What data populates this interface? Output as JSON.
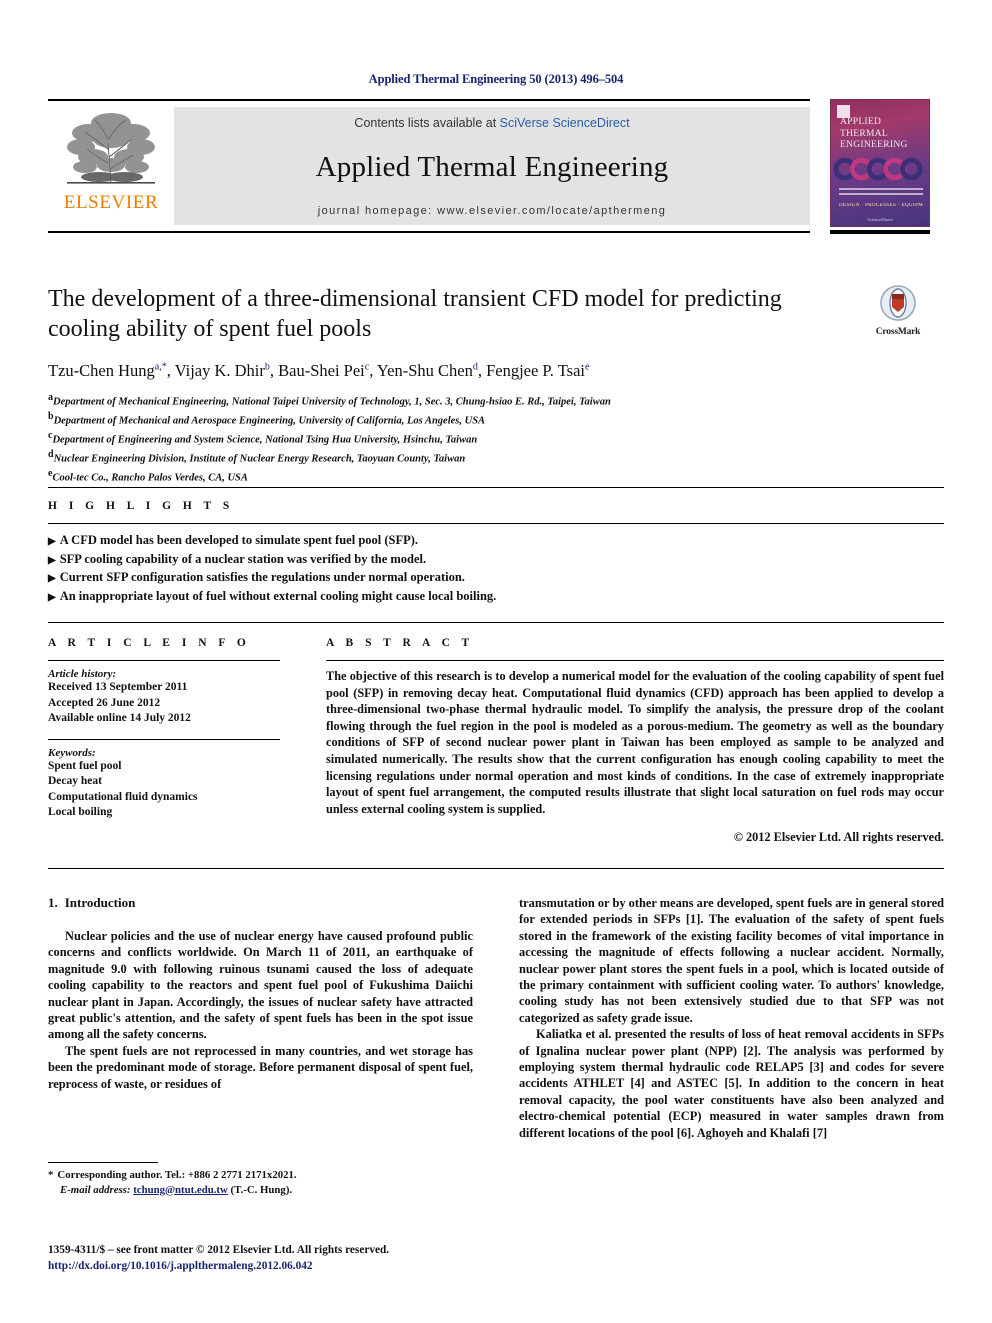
{
  "running_head": "Applied Thermal Engineering 50 (2013) 496–504",
  "masthead": {
    "contents_prefix": "Contents lists available at ",
    "contents_link": "SciVerse ScienceDirect",
    "journal_name": "Applied Thermal Engineering",
    "homepage": "journal homepage: www.elsevier.com/locate/apthermeng",
    "publisher_wordmark": "ELSEVIER",
    "publisher_logo_icon": "elsevier-tree-icon"
  },
  "cover": {
    "title_line1": "APPLIED",
    "title_line2": "THERMAL",
    "title_line3": "ENGINEERING",
    "keywords_strip": "DESIGN · PROCESSES · EQUIPMENT · ECONOMICS",
    "footer": "ScienceDirect"
  },
  "article": {
    "title": "The development of a three-dimensional transient CFD model for predicting cooling ability of spent fuel pools",
    "authors": [
      {
        "name": "Tzu-Chen Hung",
        "marks": "a,*"
      },
      {
        "name": "Vijay K. Dhir",
        "marks": "b"
      },
      {
        "name": "Bau-Shei Pei",
        "marks": "c"
      },
      {
        "name": "Yen-Shu Chen",
        "marks": "d"
      },
      {
        "name": "Fengjee P. Tsai",
        "marks": "e"
      }
    ],
    "affiliations": [
      {
        "mark": "a",
        "text": "Department of Mechanical Engineering, National Taipei University of Technology, 1, Sec. 3, Chung-hsiao E. Rd., Taipei, Taiwan"
      },
      {
        "mark": "b",
        "text": "Department of Mechanical and Aerospace Engineering, University of California, Los Angeles, USA"
      },
      {
        "mark": "c",
        "text": "Department of Engineering and System Science, National Tsing Hua University, Hsinchu, Taiwan"
      },
      {
        "mark": "d",
        "text": "Nuclear Engineering Division, Institute of Nuclear Energy Research, Taoyuan County, Taiwan"
      },
      {
        "mark": "e",
        "text": "Cool-tec Co., Rancho Palos Verdes, CA, USA"
      }
    ]
  },
  "crossmark": {
    "label": "CrossMark",
    "icon": "crossmark-icon"
  },
  "highlights": {
    "heading": "H I G H L I G H T S",
    "bullet_glyph": "▶",
    "items": [
      "A CFD model has been developed to simulate spent fuel pool (SFP).",
      "SFP cooling capability of a nuclear station was verified by the model.",
      "Current SFP configuration satisfies the regulations under normal operation.",
      "An inappropriate layout of fuel without external cooling might cause local boiling."
    ]
  },
  "article_info": {
    "heading": "A R T I C L E   I N F O",
    "history_label": "Article history:",
    "history": [
      "Received 13 September 2011",
      "Accepted 26 June 2012",
      "Available online 14 July 2012"
    ],
    "keywords_label": "Keywords:",
    "keywords": [
      "Spent fuel pool",
      "Decay heat",
      "Computational fluid dynamics",
      "Local boiling"
    ]
  },
  "abstract": {
    "heading": "A B S T R A C T",
    "text": "The objective of this research is to develop a numerical model for the evaluation of the cooling capability of spent fuel pool (SFP) in removing decay heat. Computational fluid dynamics (CFD) approach has been applied to develop a three-dimensional two-phase thermal hydraulic model. To simplify the analysis, the pressure drop of the coolant flowing through the fuel region in the pool is modeled as a porous-medium. The geometry as well as the boundary conditions of SFP of second nuclear power plant in Taiwan has been employed as sample to be analyzed and simulated numerically. The results show that the current configuration has enough cooling capability to meet the licensing regulations under normal operation and most kinds of conditions. In the case of extremely inappropriate layout of spent fuel arrangement, the computed results illustrate that slight local saturation on fuel rods may occur unless external cooling system is supplied.",
    "copyright": "© 2012 Elsevier Ltd. All rights reserved."
  },
  "body": {
    "section_number": "1.",
    "section_title": "Introduction",
    "left_paragraphs": [
      "Nuclear policies and the use of nuclear energy have caused profound public concerns and conflicts worldwide. On March 11 of 2011, an earthquake of magnitude 9.0 with following ruinous tsunami caused the loss of adequate cooling capability to the reactors and spent fuel pool of Fukushima Daiichi nuclear plant in Japan. Accordingly, the issues of nuclear safety have attracted great public's attention, and the safety of spent fuels has been in the spot issue among all the safety concerns.",
      "The spent fuels are not reprocessed in many countries, and wet storage has been the predominant mode of storage. Before permanent disposal of spent fuel, reprocess of waste, or residues of"
    ],
    "right_paragraphs": [
      "transmutation or by other means are developed, spent fuels are in general stored for extended periods in SFPs [1]. The evaluation of the safety of spent fuels stored in the framework of the existing facility becomes of vital importance in accessing the magnitude of effects following a nuclear accident. Normally, nuclear power plant stores the spent fuels in a pool, which is located outside of the primary containment with sufficient cooling water. To authors' knowledge, cooling study has not been extensively studied due to that SFP was not categorized as safety grade issue.",
      "Kaliatka et al. presented the results of loss of heat removal accidents in SFPs of Ignalina nuclear power plant (NPP) [2]. The analysis was performed by employing system thermal hydraulic code RELAP5 [3] and codes for severe accidents ATHLET [4] and ASTEC [5]. In addition to the concern in heat removal capacity, the pool water constituents have also been analyzed and electro-chemical potential (ECP) measured in water samples drawn from different locations of the pool [6]. Aghoyeh and Khalafi [7]"
    ]
  },
  "footnote": {
    "star": "*",
    "corresponding": "Corresponding author. Tel.: +886 2 2771 2171x2021.",
    "email_label": "E-mail address:",
    "email": "tchung@ntut.edu.tw",
    "email_suffix": "(T.-C. Hung)."
  },
  "colophon": {
    "issn_line": "1359-4311/$ – see front matter © 2012 Elsevier Ltd. All rights reserved.",
    "doi": "http://dx.doi.org/10.1016/j.applthermaleng.2012.06.042"
  },
  "colors": {
    "link_blue": "#17256e",
    "sciencedirect_blue": "#2a5caa",
    "elsevier_orange": "#f07d00",
    "masthead_gray": "#e3e3e3"
  }
}
